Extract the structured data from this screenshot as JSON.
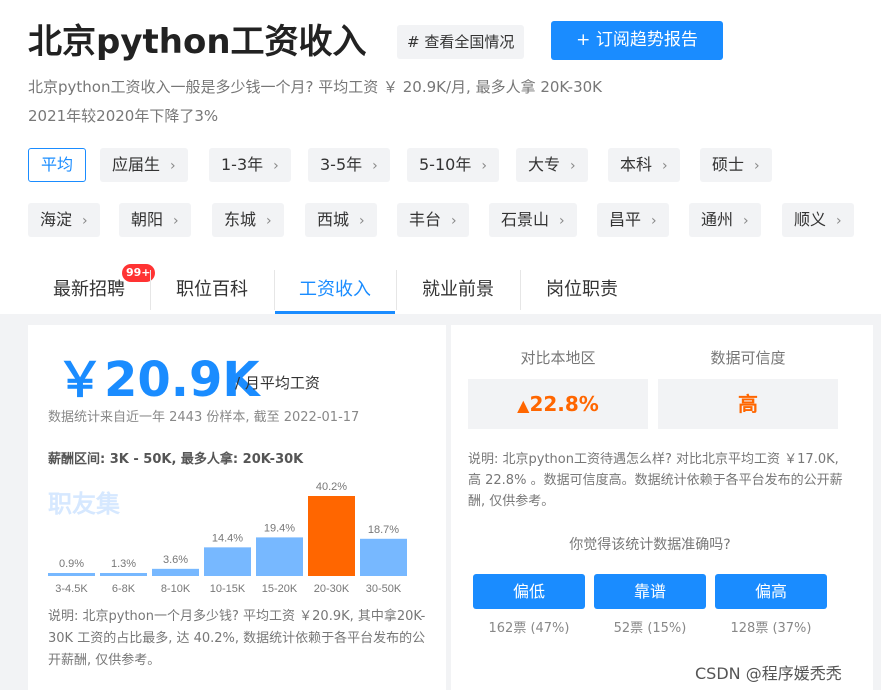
{
  "header": {
    "title": "北京python工资收入",
    "national_label": "# 查看全国情况",
    "subscribe_label": "+ 订阅趋势报告",
    "desc_line1": "北京python工资收入一般是多少钱一个月? 平均工资 ￥ 20.9K/月, 最多人拿 20K-30K",
    "desc_line2": "2021年较2020年下降了3%"
  },
  "experience_filters": [
    "平均",
    "应届生",
    "1-3年",
    "3-5年",
    "5-10年",
    "大专",
    "本科",
    "硕士"
  ],
  "district_filters": [
    "海淀",
    "朝阳",
    "东城",
    "西城",
    "丰台",
    "石景山",
    "昌平",
    "通州",
    "顺义"
  ],
  "tabs": [
    "最新招聘",
    "职位百科",
    "工资收入",
    "就业前景",
    "岗位职责"
  ],
  "badge": "99+",
  "salary": {
    "average": "￥20.9K",
    "unit": "/ 月平均工资",
    "stat_line": "数据统计来自近一年 2443 份样本, 截至 2022-01-17",
    "range_line": "薪酬区间: 3K - 50K, 最多人拿: 20K-30K",
    "watermark": "职友集",
    "note": "说明: 北京python一个月多少钱? 平均工资 ￥20.9K, 其中拿20K-30K 工资的占比最多, 达 40.2%, 数据统计依赖于各平台发布的公开薪酬, 仅供参考。"
  },
  "chart_data": {
    "type": "bar",
    "categories": [
      "3-4.5K",
      "6-8K",
      "8-10K",
      "10-15K",
      "15-20K",
      "20-30K",
      "30-50K"
    ],
    "values": [
      0.9,
      1.3,
      3.6,
      14.4,
      19.4,
      40.2,
      18.7
    ],
    "labels": [
      "0.9%",
      "1.3%",
      "3.6%",
      "14.4%",
      "19.4%",
      "40.2%",
      "18.7%"
    ],
    "highlight_index": 5,
    "bar_color": "#77b8ff",
    "highlight_color": "#ff6600"
  },
  "compare": {
    "region_label": "对比本地区",
    "region_value": "22.8%",
    "credibility_label": "数据可信度",
    "credibility_value": "高",
    "note": "说明: 北京python工资待遇怎么样? 对比北京平均工资 ￥17.0K, 高 22.8% 。数据可信度高。数据统计依赖于各平台发布的公开薪酬, 仅供参考。",
    "question": "你觉得该统计数据准确吗?"
  },
  "votes": [
    {
      "label": "偏低",
      "count": "162票 (47%)"
    },
    {
      "label": "靠谱",
      "count": "52票 (15%)"
    },
    {
      "label": "偏高",
      "count": "128票 (37%)"
    }
  ],
  "credit": "CSDN @程序媛秃秃"
}
